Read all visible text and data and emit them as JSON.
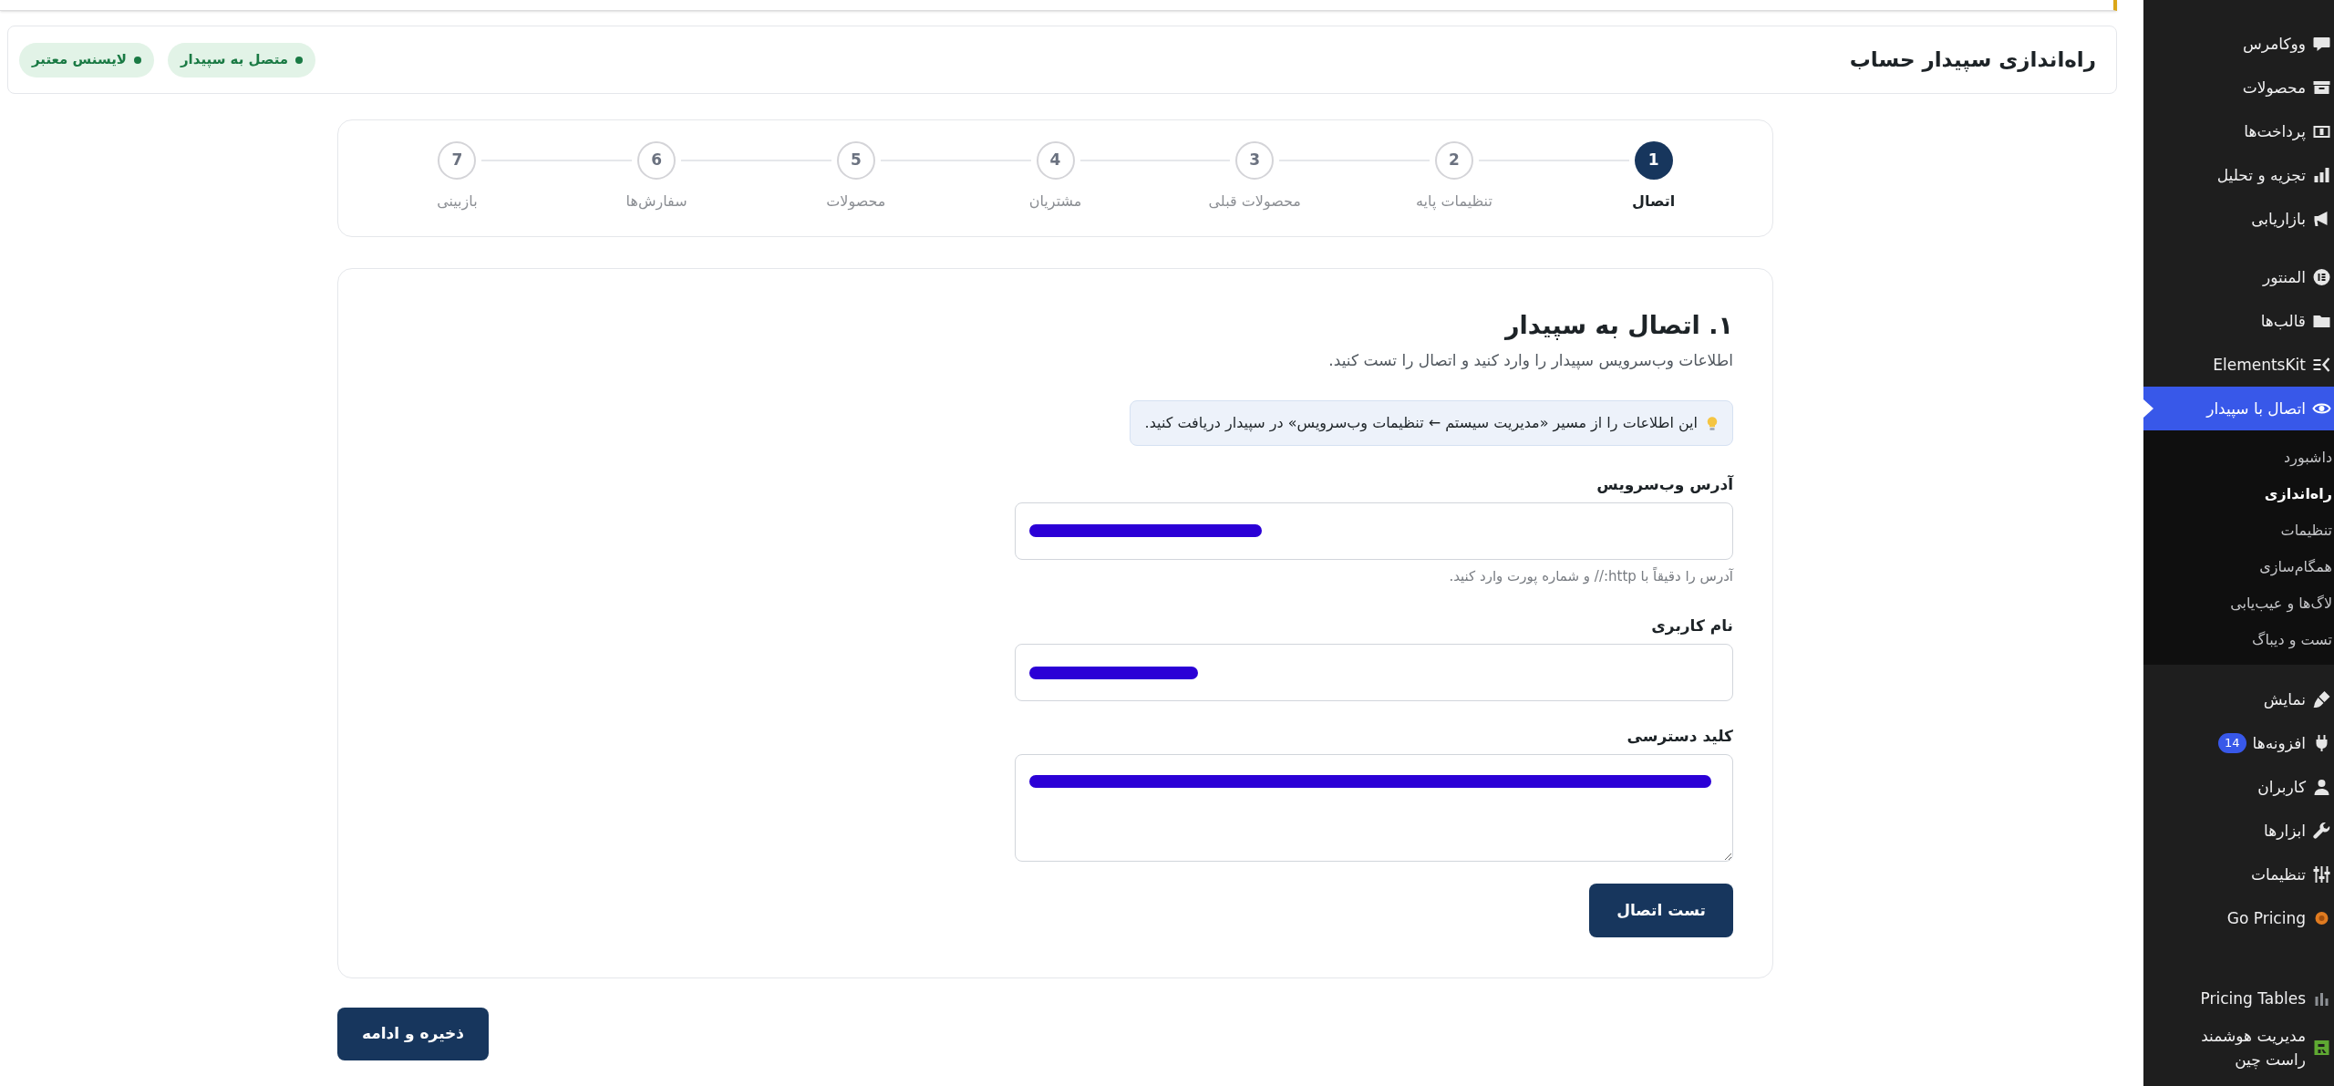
{
  "header": {
    "title": "راه‌اندازی سپیدار حساب",
    "badges": [
      {
        "label": "متصل به سپیدار"
      },
      {
        "label": "لایسنس معتبر"
      }
    ]
  },
  "stepper": {
    "steps": [
      {
        "number": "1",
        "label": "اتصال",
        "selected": true
      },
      {
        "number": "2",
        "label": "تنظیمات پایه",
        "selected": false
      },
      {
        "number": "3",
        "label": "محصولات قبلی",
        "selected": false
      },
      {
        "number": "4",
        "label": "مشتریان",
        "selected": false
      },
      {
        "number": "5",
        "label": "محصولات",
        "selected": false
      },
      {
        "number": "6",
        "label": "سفارش‌ها",
        "selected": false
      },
      {
        "number": "7",
        "label": "بازبینی",
        "selected": false
      }
    ]
  },
  "section": {
    "title": "۱. اتصال به سپیدار",
    "subtitle": "اطلاعات وب‌سرویس سپیدار را وارد کنید و اتصال را تست کنید.",
    "info": "این اطلاعات را از مسیر «مدیریت سیستم ← تنظیمات وب‌سرویس» در سپیدار دریافت کنید.",
    "fields": [
      {
        "kind": "input",
        "label": "آدرس وب‌سرویس",
        "redacted": true,
        "hint": "آدرس را دقیقاً با http:// و شماره پورت وارد کنید."
      },
      {
        "kind": "input",
        "label": "نام کاربری",
        "redacted": true
      },
      {
        "kind": "textarea",
        "label": "کلید دسترسی",
        "redacted": true
      }
    ],
    "test_button": "تست اتصال"
  },
  "save_button": "ذخیره و ادامه",
  "sidebar": {
    "groups": [
      {
        "items": [
          {
            "label": "ووکامرس",
            "selected": false
          },
          {
            "label": "محصولات",
            "selected": false
          },
          {
            "label": "پرداخت‌ها",
            "selected": false
          },
          {
            "label": "تجزیه و تحلیل",
            "selected": false
          },
          {
            "label": "بازاریابی",
            "selected": false
          }
        ]
      },
      {
        "items": [
          {
            "label": "المنتور",
            "selected": false
          },
          {
            "label": "قالب‌ها",
            "selected": false
          },
          {
            "label": "ElementsKit",
            "selected": false
          },
          {
            "label": "اتصال با سپیدار",
            "selected": true,
            "children": [
              {
                "label": "داشبورد",
                "selected": false
              },
              {
                "label": "راه‌اندازی",
                "selected": true
              },
              {
                "label": "تنظیمات",
                "selected": false
              },
              {
                "label": "همگام‌سازی",
                "selected": false
              },
              {
                "label": "لاگ‌ها و عیب‌یابی",
                "selected": false
              },
              {
                "label": "تست و دیباگ",
                "selected": false
              }
            ]
          },
          {
            "label": "نمایش",
            "selected": false
          },
          {
            "label": "افزونه‌ها",
            "selected": false,
            "badge": "14"
          },
          {
            "label": "کاربران",
            "selected": false
          },
          {
            "label": "ابزارها",
            "selected": false
          },
          {
            "label": "تنظیمات",
            "selected": false
          },
          {
            "label": "Go Pricing",
            "selected": false
          }
        ]
      },
      {
        "items": [
          {
            "label": "Pricing Tables",
            "selected": false
          },
          {
            "label": "مدیریت هوشمند راست چین",
            "selected": false
          }
        ]
      }
    ]
  }
}
